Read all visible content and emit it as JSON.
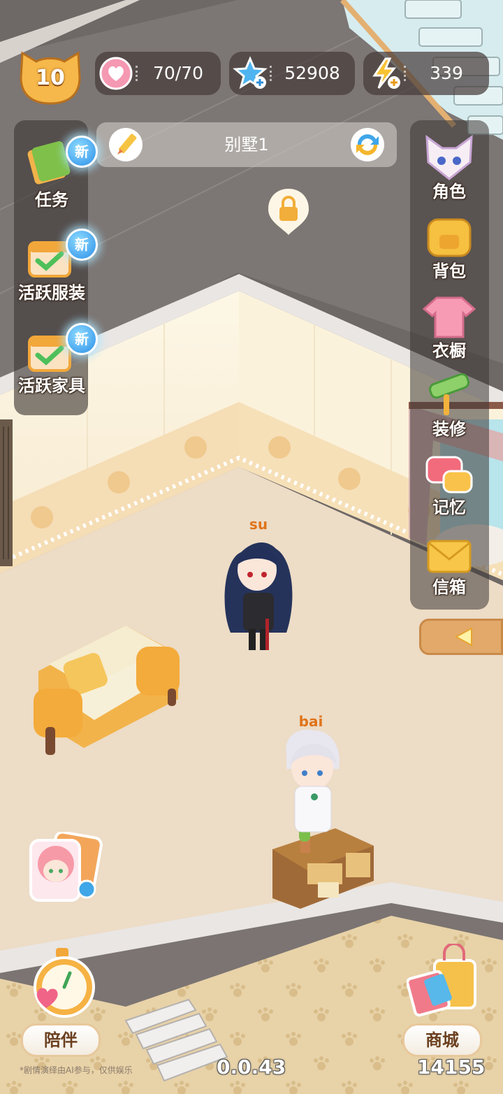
{
  "hud": {
    "level": "10",
    "hearts": "70/70",
    "stars": "52908",
    "energy": "339"
  },
  "room": {
    "title": "别墅1"
  },
  "left_menu": {
    "tasks": {
      "label": "任务",
      "badge": "新"
    },
    "active_outfit": {
      "label": "活跃服装",
      "badge": "新"
    },
    "active_furniture": {
      "label": "活跃家具",
      "badge": "新"
    }
  },
  "right_menu": {
    "character": "角色",
    "backpack": "背包",
    "wardrobe": "衣橱",
    "decorate": "装修",
    "memory": "记忆",
    "mailbox": "信箱"
  },
  "characters": {
    "su": "su",
    "bai": "bai"
  },
  "bottom": {
    "companion_label": "陪伴",
    "shop_label": "商城",
    "version": "0.0.43",
    "shop_number": "14155",
    "disclaimer": "*剧情演绎由AI参与，仅供娱乐"
  },
  "colors": {
    "accent_orange": "#f2a93b",
    "wall_cream": "#fbf2dc",
    "floor_beige": "#eddcc6",
    "hud_dark": "#463c3a"
  }
}
